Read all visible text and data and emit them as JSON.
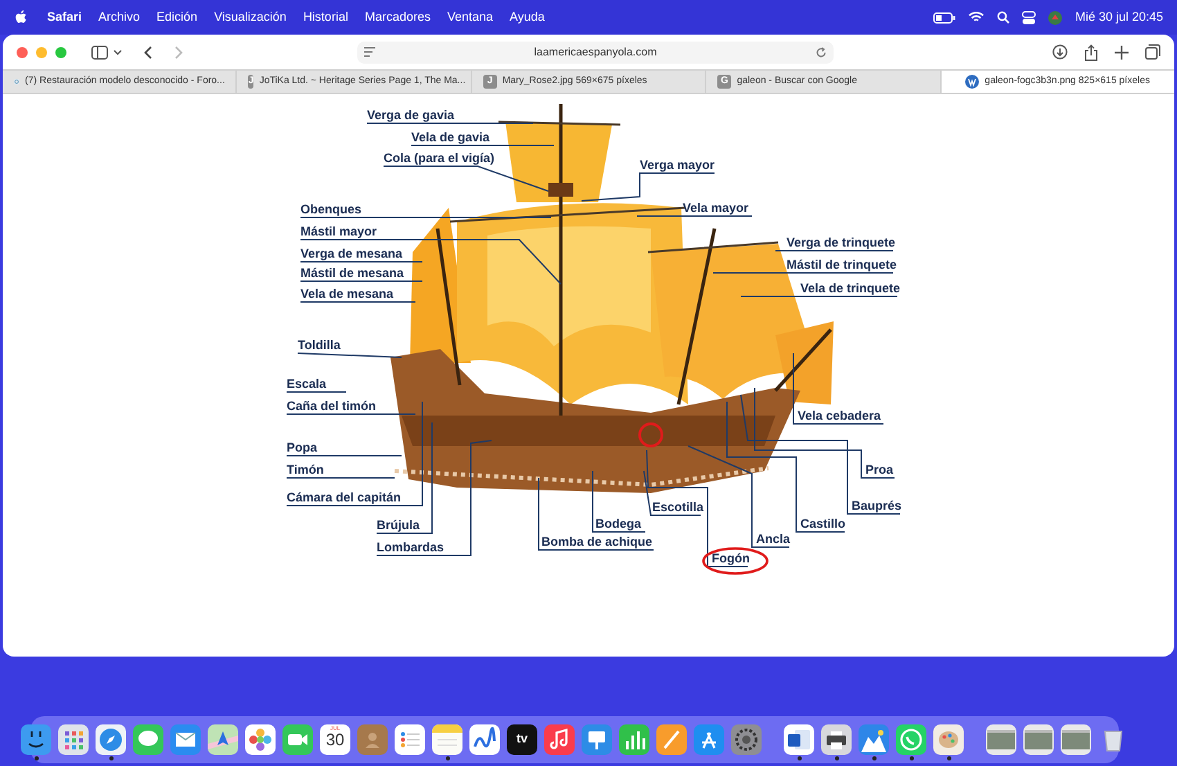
{
  "menu_bar": {
    "app": "Safari",
    "items": [
      "Archivo",
      "Edición",
      "Visualización",
      "Historial",
      "Marcadores",
      "Ventana",
      "Ayuda"
    ],
    "clock": "Mié 30 jul 20:45"
  },
  "toolbar": {
    "address": "laamericaespanyola.com"
  },
  "tabs": [
    {
      "kind": "forum",
      "title": "(7) Restauración modelo desconocido - Foro...",
      "selected": false
    },
    {
      "kind": "letter",
      "letter": "J",
      "title": "JoTiKa Ltd. ~ Heritage Series Page 1, The Ma...",
      "selected": false
    },
    {
      "kind": "letter",
      "letter": "J",
      "title": "Mary_Rose2.jpg 569×675 píxeles",
      "selected": false
    },
    {
      "kind": "letter",
      "letter": "G",
      "title": "galeon - Buscar con Google",
      "selected": false
    },
    {
      "kind": "wordpress",
      "title": "galeon-fogc3b3n.png 825×615 píxeles",
      "selected": true
    }
  ],
  "diagram": {
    "labels": [
      {
        "text": "Verga de gavia",
        "circled": false
      },
      {
        "text": "Vela de gavia",
        "circled": false
      },
      {
        "text": "Cola (para el vigía)",
        "circled": false
      },
      {
        "text": "Obenques",
        "circled": false
      },
      {
        "text": "Mástil mayor",
        "circled": false
      },
      {
        "text": "Verga de mesana",
        "circled": false
      },
      {
        "text": "Mástil de mesana",
        "circled": false
      },
      {
        "text": "Vela de mesana",
        "circled": false
      },
      {
        "text": "Toldilla",
        "circled": false
      },
      {
        "text": "Escala",
        "circled": false
      },
      {
        "text": "Caña del timón",
        "circled": false
      },
      {
        "text": "Popa",
        "circled": false
      },
      {
        "text": "Timón",
        "circled": false
      },
      {
        "text": "Cámara del capitán",
        "circled": false
      },
      {
        "text": "Brújula",
        "circled": false
      },
      {
        "text": "Lombardas",
        "circled": false
      },
      {
        "text": "Verga mayor",
        "circled": false
      },
      {
        "text": "Vela mayor",
        "circled": false
      },
      {
        "text": "Verga de trinquete",
        "circled": false
      },
      {
        "text": "Mástil de trinquete",
        "circled": false
      },
      {
        "text": "Vela de trinquete",
        "circled": false
      },
      {
        "text": "Vela cebadera",
        "circled": false
      },
      {
        "text": "Proa",
        "circled": false
      },
      {
        "text": "Bauprés",
        "circled": false
      },
      {
        "text": "Escotilla",
        "circled": false
      },
      {
        "text": "Bodega",
        "circled": false
      },
      {
        "text": "Bomba de achique",
        "circled": false
      },
      {
        "text": "Castillo",
        "circled": false
      },
      {
        "text": "Ancla",
        "circled": false
      },
      {
        "text": "Fogón",
        "circled": true
      }
    ]
  },
  "dock": {
    "items": [
      {
        "kind": "finder",
        "running": true
      },
      {
        "kind": "launchpad",
        "running": false
      },
      {
        "kind": "safari",
        "running": true
      },
      {
        "kind": "messages",
        "running": false
      },
      {
        "kind": "mail",
        "running": false
      },
      {
        "kind": "maps",
        "running": false
      },
      {
        "kind": "photos",
        "running": false
      },
      {
        "kind": "facetime",
        "running": false
      },
      {
        "kind": "calendar",
        "month": "JUL",
        "day": "30",
        "running": false
      },
      {
        "kind": "contacts",
        "running": false
      },
      {
        "kind": "reminders",
        "running": false
      },
      {
        "kind": "notes",
        "running": true
      },
      {
        "kind": "freeform",
        "running": false
      },
      {
        "kind": "tv",
        "label": "tv",
        "running": false
      },
      {
        "kind": "music",
        "running": false
      },
      {
        "kind": "keynote",
        "running": false
      },
      {
        "kind": "numbers",
        "running": false
      },
      {
        "kind": "pages",
        "running": false
      },
      {
        "kind": "appstore",
        "running": false
      },
      {
        "kind": "settings",
        "running": false
      },
      {
        "kind": "separator"
      },
      {
        "kind": "word",
        "running": true
      },
      {
        "kind": "printer",
        "running": true
      },
      {
        "kind": "weather",
        "running": true
      },
      {
        "kind": "whatsapp",
        "running": true
      },
      {
        "kind": "paint",
        "running": true
      },
      {
        "kind": "separator"
      },
      {
        "kind": "window",
        "running": false
      },
      {
        "kind": "window",
        "running": false
      },
      {
        "kind": "window",
        "running": false
      },
      {
        "kind": "trash",
        "running": false
      }
    ]
  }
}
